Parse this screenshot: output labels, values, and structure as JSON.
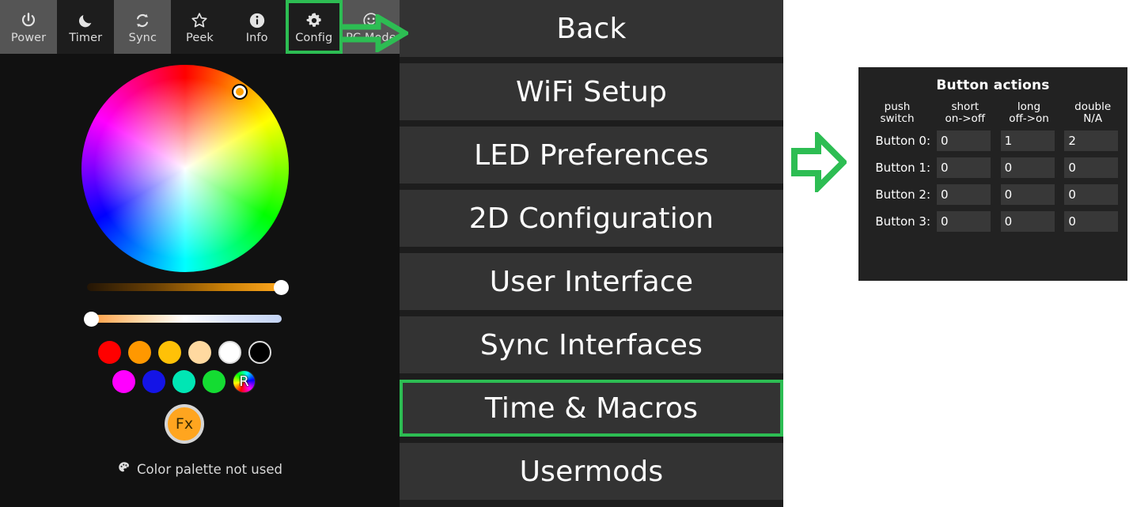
{
  "toolbar": {
    "buttons": [
      {
        "label": "Power",
        "icon": "power-icon",
        "shade": "light",
        "highlighted": false
      },
      {
        "label": "Timer",
        "icon": "moon-icon",
        "shade": "dark",
        "highlighted": false
      },
      {
        "label": "Sync",
        "icon": "sync-icon",
        "shade": "light",
        "highlighted": false
      },
      {
        "label": "Peek",
        "icon": "star-icon",
        "shade": "dark",
        "highlighted": false
      },
      {
        "label": "Info",
        "icon": "info-icon",
        "shade": "dark",
        "highlighted": false
      },
      {
        "label": "Config",
        "icon": "gear-icon",
        "shade": "dark",
        "highlighted": true
      },
      {
        "label": "PC Mode",
        "icon": "smiley-icon",
        "shade": "light",
        "highlighted": false
      }
    ]
  },
  "color_picker": {
    "wheel_marker_color": "#ffa000",
    "sliders": [
      {
        "name": "brightness",
        "value_pct": 100
      },
      {
        "name": "color-temperature",
        "value_pct": 0
      }
    ],
    "quick_colors_row1": [
      {
        "name": "red",
        "hex": "#ff0000"
      },
      {
        "name": "orange",
        "hex": "#ff9800"
      },
      {
        "name": "amber",
        "hex": "#ffc107"
      },
      {
        "name": "peach",
        "hex": "#ffd9a0"
      },
      {
        "name": "white",
        "hex": "#ffffff"
      },
      {
        "name": "black",
        "hex": "#000000"
      }
    ],
    "quick_colors_row2": [
      {
        "name": "magenta",
        "hex": "#ff00ff"
      },
      {
        "name": "blue",
        "hex": "#1414e6"
      },
      {
        "name": "spring-green",
        "hex": "#00e6b4"
      },
      {
        "name": "green",
        "hex": "#14dc32"
      },
      {
        "name": "rainbow",
        "hex": "rainbow",
        "char": "R"
      }
    ],
    "fx_label": "Fx",
    "palette_status": "Color palette not used",
    "palette_icon": "palette-icon"
  },
  "menu": {
    "items": [
      {
        "label": "Back",
        "selected": false
      },
      {
        "label": "WiFi Setup",
        "selected": false
      },
      {
        "label": "LED Preferences",
        "selected": false
      },
      {
        "label": "2D Configuration",
        "selected": false
      },
      {
        "label": "User Interface",
        "selected": false
      },
      {
        "label": "Sync Interfaces",
        "selected": false
      },
      {
        "label": "Time & Macros",
        "selected": true
      },
      {
        "label": "Usermods",
        "selected": false
      }
    ]
  },
  "button_actions": {
    "title": "Button actions",
    "columns": [
      {
        "line1": "push",
        "line2": "switch"
      },
      {
        "line1": "short",
        "line2": "on->off"
      },
      {
        "line1": "long",
        "line2": "off->on"
      },
      {
        "line1": "double",
        "line2": "N/A"
      }
    ],
    "rows": [
      {
        "label": "Button 0:",
        "values": [
          "0",
          "1",
          "2"
        ]
      },
      {
        "label": "Button 1:",
        "values": [
          "0",
          "0",
          "0"
        ]
      },
      {
        "label": "Button 2:",
        "values": [
          "0",
          "0",
          "0"
        ]
      },
      {
        "label": "Button 3:",
        "values": [
          "0",
          "0",
          "0"
        ]
      }
    ]
  },
  "annotations": {
    "accent_color": "#2dbd53",
    "arrows": [
      {
        "name": "arrow-to-button-actions",
        "direction": "right"
      },
      {
        "name": "arrow-to-pc-mode",
        "direction": "right"
      }
    ]
  }
}
